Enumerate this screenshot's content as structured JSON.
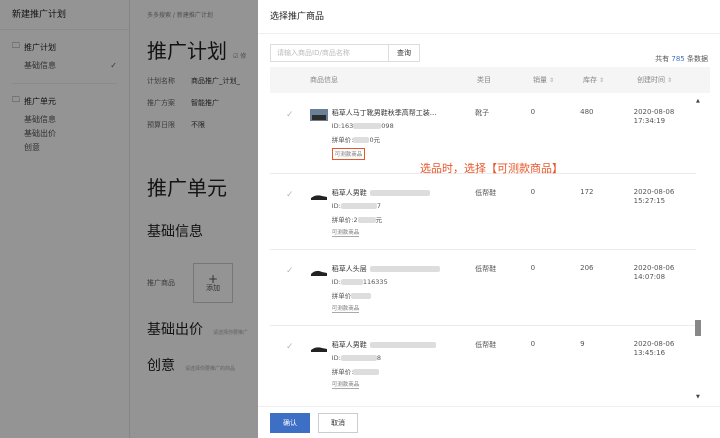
{
  "nav": {
    "title": "新建推广计划",
    "group1": {
      "head": "推广计划",
      "items": [
        {
          "label": "基础信息",
          "check": "✓"
        }
      ]
    },
    "group2": {
      "head": "推广单元",
      "items": [
        "基础信息",
        "基础出价",
        "创意"
      ]
    }
  },
  "page": {
    "breadcrumb": "多多搜索 / 新建推广计划",
    "plan_title": "推广计划",
    "plan_edit": "☑ 修",
    "kv": [
      {
        "k": "计划名称",
        "v": "商品推广_计划_"
      },
      {
        "k": "推广方案",
        "v": "智能推广"
      },
      {
        "k": "预算日限",
        "v": "不限"
      }
    ],
    "unit_title": "推广单元",
    "basic_info": "基础信息",
    "product_label": "推广商品",
    "add_label": "添加",
    "bid_title": "基础出价",
    "bid_hint": "请选择你要推广",
    "creative_title": "创意",
    "creative_hint": "请选择你要推广的商品"
  },
  "drawer": {
    "title": "选择推广商品",
    "search_placeholder": "请输入商品ID/商品名称",
    "search_button": "查询",
    "count_prefix": "共有",
    "count_value": "785",
    "count_suffix": "条数据",
    "columns": [
      "商品信息",
      "类目",
      "销量",
      "库存",
      "创建时间"
    ],
    "rows": [
      {
        "name": "稻草人马丁靴男鞋秋季高帮工装...",
        "id": "ID:163",
        "id_tail": "098",
        "price": "拼单价:",
        "price_tail": "0元",
        "tag": "可测款商品",
        "category": "靴子",
        "sales": "0",
        "stock": "480",
        "date": "2020-08-08",
        "time": "17:34:19"
      },
      {
        "name": "稻草人男鞋",
        "id": "ID:",
        "id_tail": "7",
        "price": "拼单价:2",
        "price_tail": "元",
        "tag": "可测款商品",
        "category": "低帮鞋",
        "sales": "0",
        "stock": "172",
        "date": "2020-08-06",
        "time": "15:27:15"
      },
      {
        "name": "稻草人头层",
        "id": "ID:",
        "id_tail": "116335",
        "price": "拼单价",
        "price_tail": "",
        "tag": "可测款商品",
        "category": "低帮鞋",
        "sales": "0",
        "stock": "206",
        "date": "2020-08-06",
        "time": "14:07:08"
      },
      {
        "name": "稻草人男鞋",
        "id": "ID:",
        "id_tail": "8",
        "price": "拼单价:",
        "price_tail": "",
        "tag": "可测款商品",
        "category": "低帮鞋",
        "sales": "0",
        "stock": "9",
        "date": "2020-08-06",
        "time": "13:45:16"
      }
    ],
    "callout": "选品时，选择【可测款商品】",
    "confirm": "确认",
    "cancel": "取消"
  },
  "colors": {
    "accent": "#3d6fc4",
    "highlight": "#e8562a"
  }
}
